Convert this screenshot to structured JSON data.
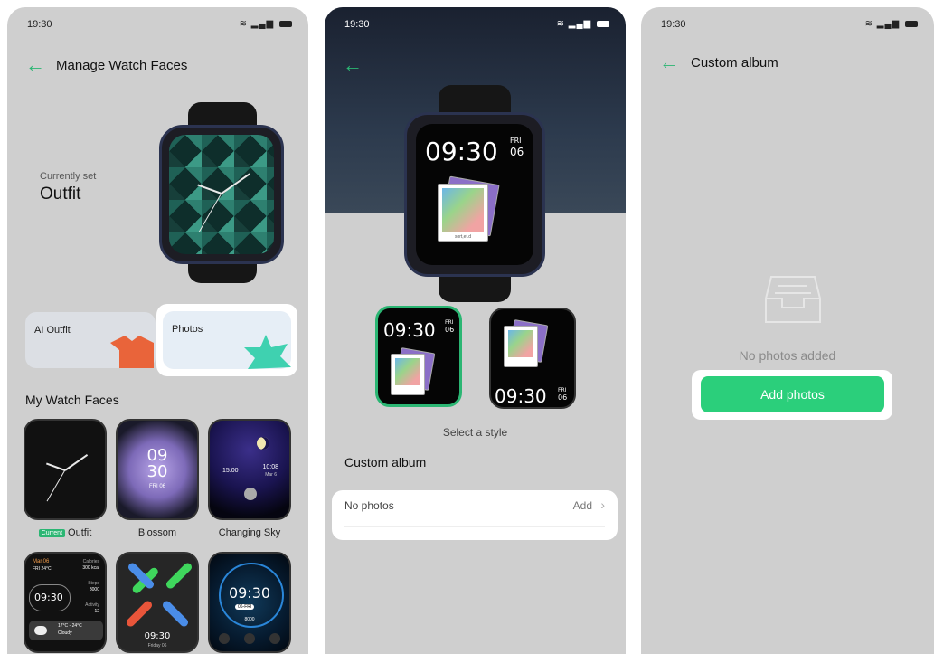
{
  "status": {
    "time": "19:30",
    "icons": "wifi signal battery"
  },
  "phone1": {
    "title": "Manage Watch Faces",
    "currently_set_label": "Currently set",
    "current_face": "Outfit",
    "tiles": [
      {
        "label": "AI Outfit"
      },
      {
        "label": "Photos"
      }
    ],
    "section_title": "My Watch Faces",
    "faces": [
      {
        "name": "Outfit",
        "badge": "Current"
      },
      {
        "name": "Blossom"
      },
      {
        "name": "Changing Sky"
      }
    ],
    "blossom_time": [
      "09",
      "30"
    ],
    "blossom_date": "FRI 06",
    "sky_left_time": "15:00",
    "sky_right_time": "10:08",
    "sky_right_date": "Mar 6",
    "info_face": {
      "date": "Mar.06",
      "weather_top": "FRI 24°C",
      "calories_label": "Calories",
      "calories_value": "300 kcal",
      "steps_label": "Steps",
      "steps_value": "8000",
      "activity_label": "Activity",
      "activity_value": "12",
      "time": "09:30",
      "weather_range": "17°C - 24°C",
      "weather_text": "Cloudy"
    },
    "x_face_time": "09:30",
    "x_face_date": "Friday 06",
    "sport_face": {
      "time": "09:30",
      "day": "06-FRI",
      "steps": "8000"
    }
  },
  "phone2": {
    "hero_time": "09:30",
    "hero_day": "FRI",
    "hero_date": "06",
    "style_time": "09:30",
    "style_day": "FRI",
    "style_date": "06",
    "select_style_label": "Select a style",
    "section_title": "Custom album",
    "row_label": "No photos",
    "row_action": "Add",
    "photo_caption": "sort,et.d"
  },
  "phone3": {
    "title": "Custom album",
    "empty_text": "No photos added",
    "add_button": "Add photos"
  },
  "colors": {
    "accent": "#2bb673",
    "button": "#2bcf7b",
    "panel": "#cfcfcf"
  }
}
